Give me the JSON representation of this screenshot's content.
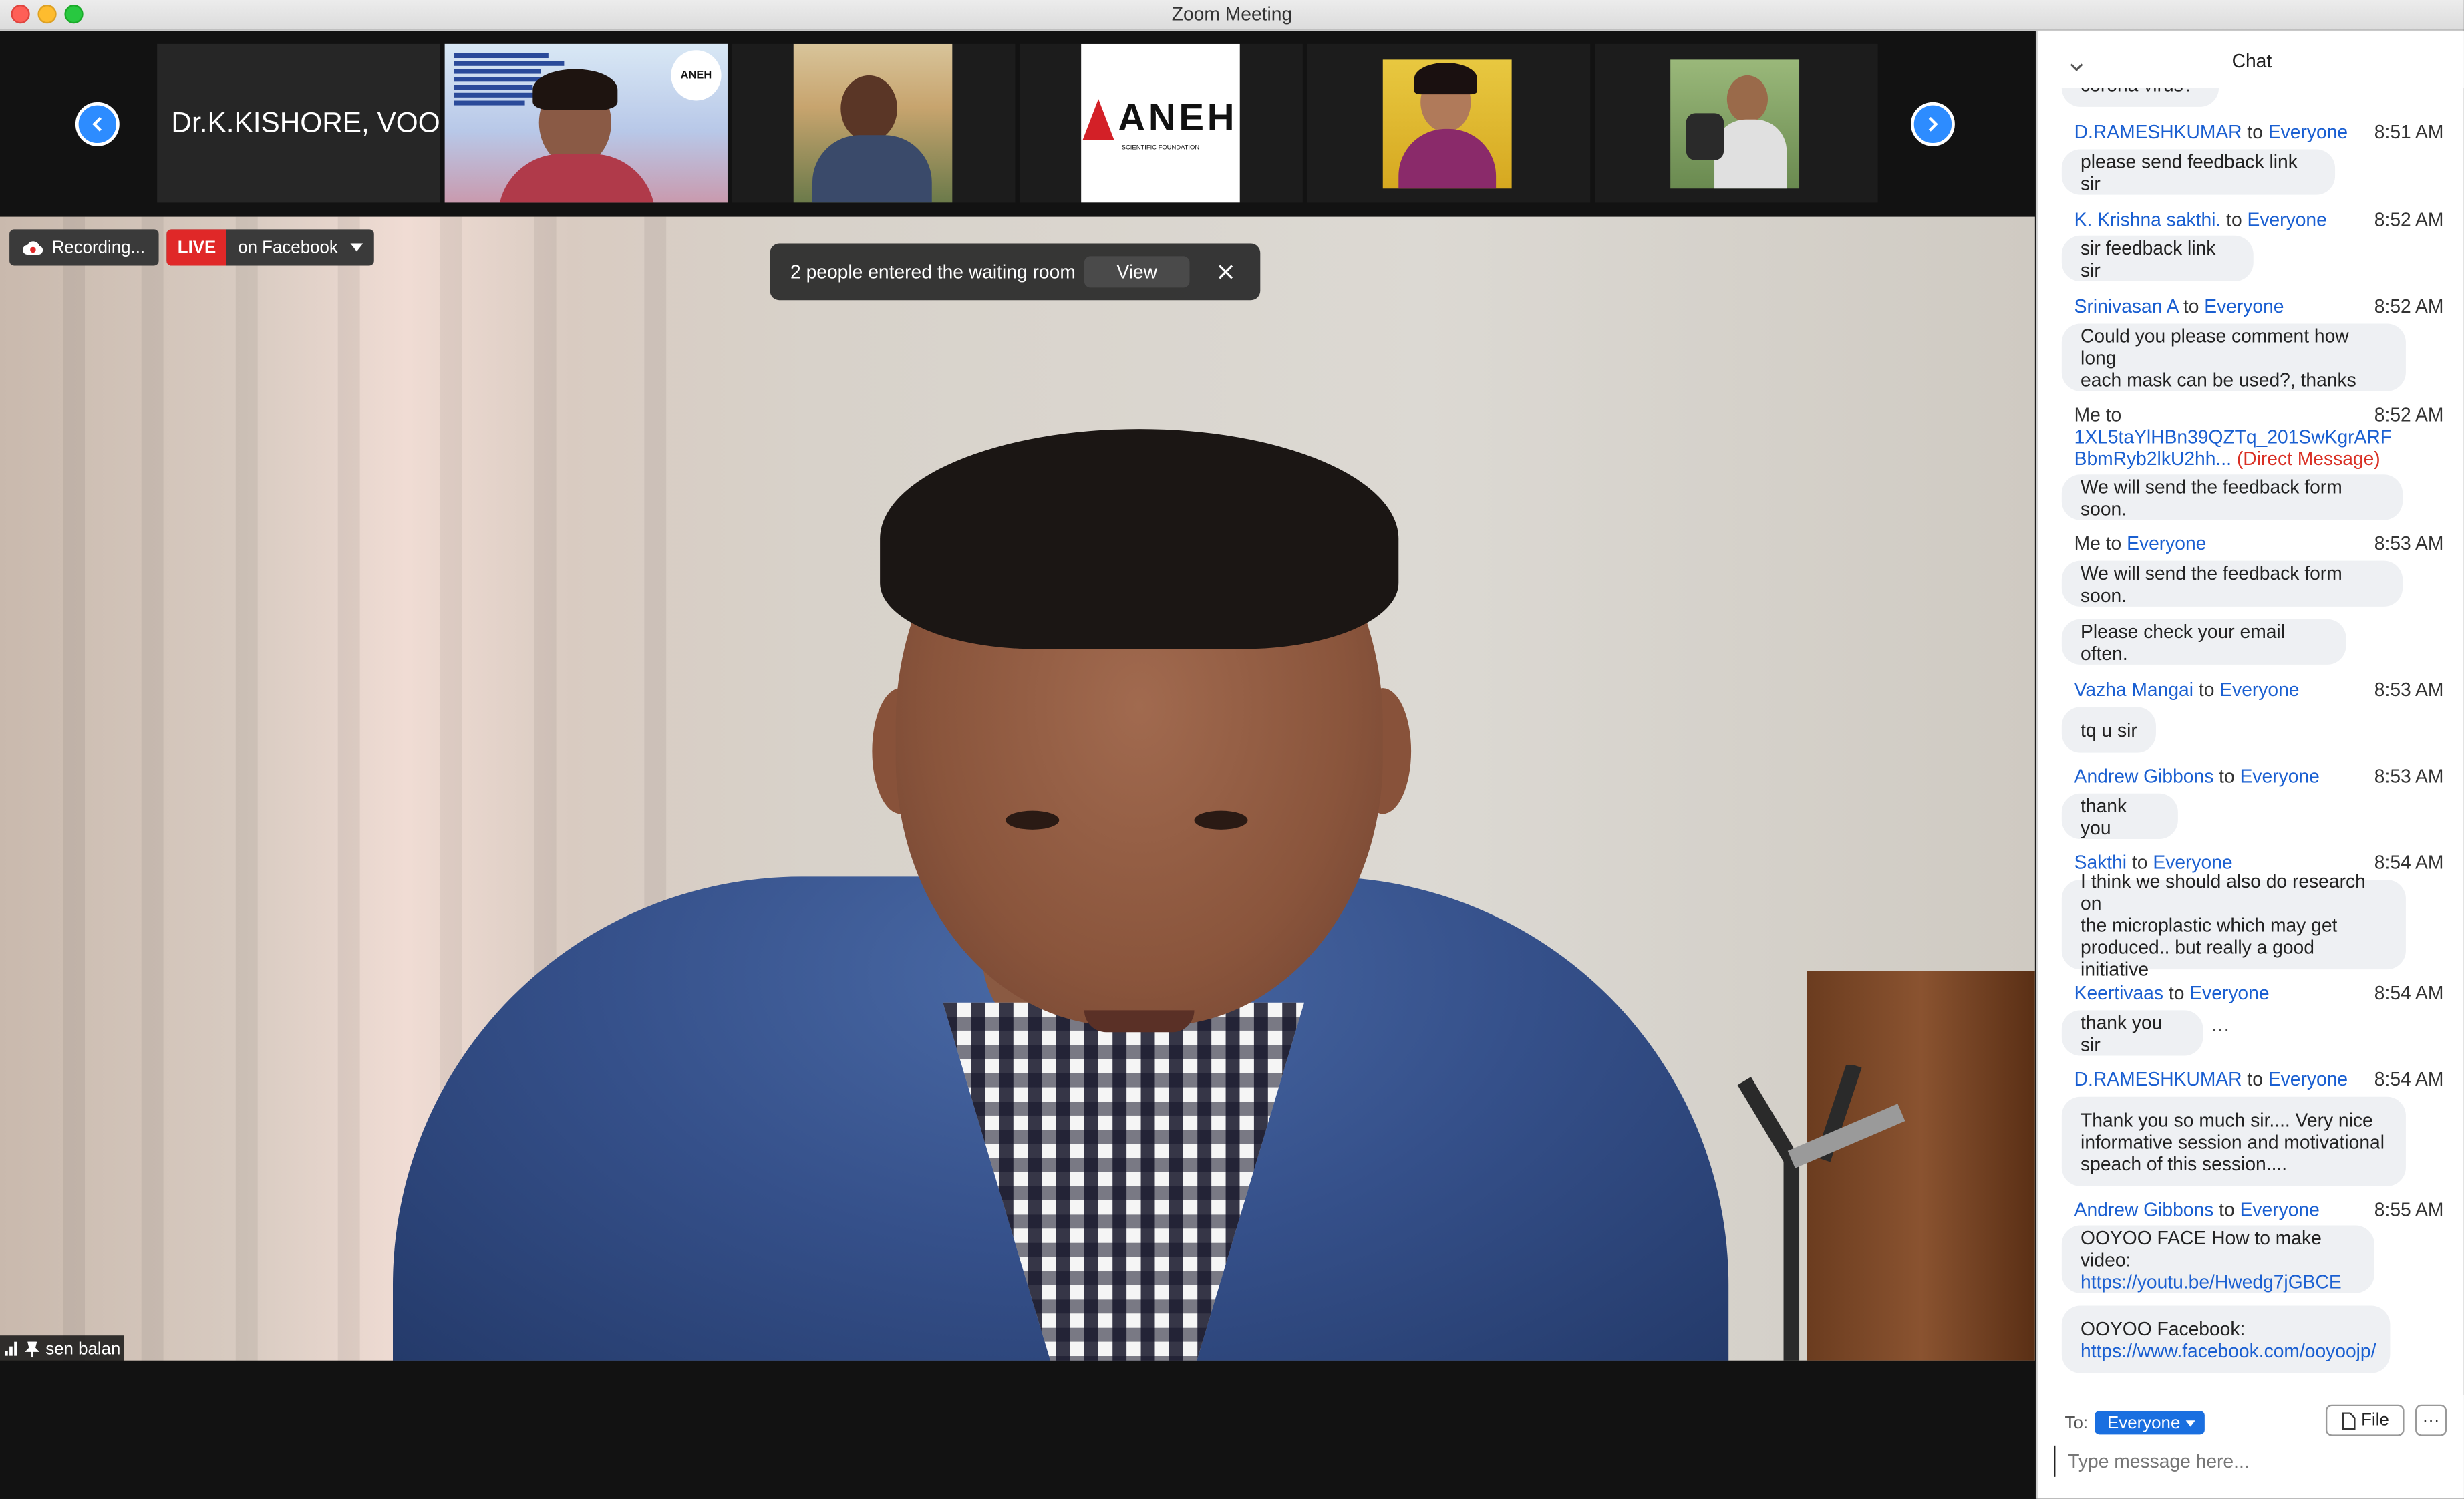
{
  "window": {
    "title": "Zoom Meeting"
  },
  "strip": {
    "first_tile_name": "Dr.K.KISHORE, VOO...",
    "aneh_logo_text": "ANEH",
    "aneh_logo_sub": "SCIENTIFIC FOUNDATION"
  },
  "recording": {
    "label": "Recording..."
  },
  "live": {
    "badge": "LIVE",
    "label": "on Facebook"
  },
  "waiting_room": {
    "message": "2 people entered the waiting room",
    "view_label": "View"
  },
  "main_video": {
    "participant_name": "sen balan"
  },
  "chat": {
    "title": "Chat",
    "partial_top_text": "corona virus?",
    "messages": [
      {
        "sender": "D.RAMESHKUMAR",
        "to_word": "to",
        "recipient": "Everyone",
        "time": "8:51 AM",
        "lines": [
          "please send feedback link sir"
        ]
      },
      {
        "sender": "K. Krishna sakthi.",
        "to_word": "to",
        "recipient": "Everyone",
        "time": "8:52 AM",
        "lines": [
          "sir feedback link sir"
        ]
      },
      {
        "sender": "Srinivasan A",
        "to_word": "to",
        "recipient": "Everyone",
        "time": "8:52 AM",
        "lines": [
          "Could you please comment how long",
          "each mask can be used?, thanks"
        ]
      },
      {
        "sender": "Me",
        "to_word": "to",
        "recipient_line1": "1XL5taYlHBn39QZTq_201SwKgrARF",
        "recipient_line2": "BbmRyb2lkU2hh...",
        "dm_label": "(Direct Message)",
        "time": "8:52 AM",
        "lines": [
          "We will send the feedback form soon."
        ]
      },
      {
        "sender": "Me",
        "to_word": "to",
        "recipient": "Everyone",
        "time": "8:53 AM",
        "lines": [
          "We will send the feedback form soon."
        ],
        "extra": "Please check your email often."
      },
      {
        "sender": "Vazha Mangai",
        "to_word": "to",
        "recipient": "Everyone",
        "time": "8:53 AM",
        "lines": [
          "tq u sir"
        ]
      },
      {
        "sender": "Andrew Gibbons",
        "to_word": "to",
        "recipient": "Everyone",
        "time": "8:53 AM",
        "lines": [
          "thank you"
        ]
      },
      {
        "sender": "Sakthi",
        "to_word": "to",
        "recipient": "Everyone",
        "time": "8:54 AM",
        "lines": [
          "I think we should also do research on",
          "the microplastic which may get",
          "produced.. but really a good initiative"
        ]
      },
      {
        "sender": "Keertivaas",
        "to_word": "to",
        "recipient": "Everyone",
        "time": "8:54 AM",
        "lines": [
          "thank you sir"
        ],
        "more": "···"
      },
      {
        "sender": "D.RAMESHKUMAR",
        "to_word": "to",
        "recipient": "Everyone",
        "time": "8:54 AM",
        "lines": [
          "Thank you so much sir.... Very nice",
          "informative session and motivational",
          "speach of this session...."
        ]
      },
      {
        "sender": "Andrew Gibbons",
        "to_word": "to",
        "recipient": "Everyone",
        "time": "8:55 AM",
        "lines": [
          "OOYOO FACE How to make video:"
        ],
        "link": "https://youtu.be/Hwedg7jGBCE"
      },
      {
        "text": "OOYOO Facebook:",
        "link": "https://www.facebook.com/ooyoojp/"
      }
    ],
    "footer": {
      "to_label": "To:",
      "recipient": "Everyone",
      "file_label": "File",
      "more_label": "···",
      "input_placeholder": "Type message here..."
    }
  },
  "colors": {
    "accent_blue": "#2d8cff",
    "live_red": "#e02828",
    "link_blue": "#1a5fd1",
    "dm_red": "#d93025"
  }
}
